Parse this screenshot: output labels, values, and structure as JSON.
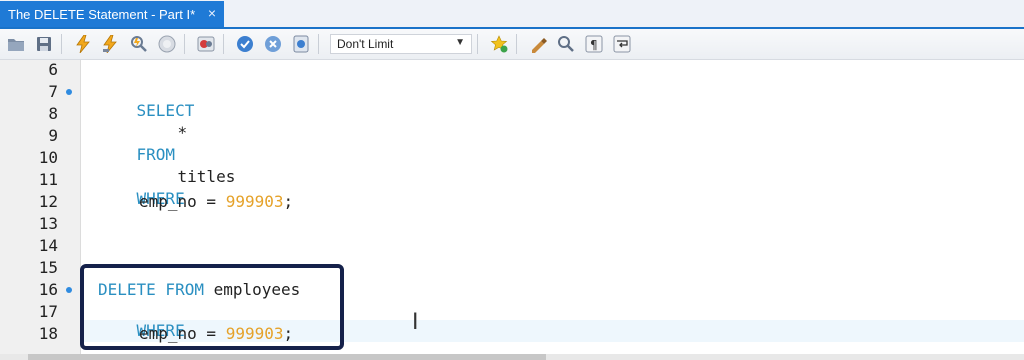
{
  "tab": {
    "title": "The DELETE Statement - Part I*",
    "close_glyph": "×"
  },
  "toolbar": {
    "limit_value": "Don't Limit",
    "icons": [
      "open-folder-icon",
      "save-icon",
      "execute-icon",
      "execute-selection-icon",
      "explain-icon",
      "stop-icon",
      "toggle-error-icon",
      "commit-icon",
      "rollback-icon",
      "autocommit-icon",
      "add-snippet-icon",
      "beautify-icon",
      "find-icon",
      "invisible-chars-icon",
      "word-wrap-icon"
    ]
  },
  "gutter": {
    "lines": [
      "6",
      "7",
      "8",
      "9",
      "10",
      "11",
      "12",
      "13",
      "14",
      "15",
      "16",
      "17",
      "18"
    ],
    "markers": [
      "7",
      "16"
    ]
  },
  "code": {
    "l7_kw": "SELECT",
    "l8_star": "*",
    "l9_kw": "FROM",
    "l10_ident": "titles",
    "l11_kw": "WHERE",
    "l12_ident": "emp_no = ",
    "l12_num": "999903",
    "l12_semi": ";",
    "l16_kw": "DELETE FROM",
    "l16_ident": " employees",
    "l17_kw": "WHERE",
    "l18_ident": "emp_no = ",
    "l18_num": "999903",
    "l18_semi": ";"
  },
  "colors": {
    "keyword": "#2a8fc1",
    "number": "#e5a22a",
    "tab_active": "#1f7ad6",
    "annotation_box": "#15214a"
  }
}
